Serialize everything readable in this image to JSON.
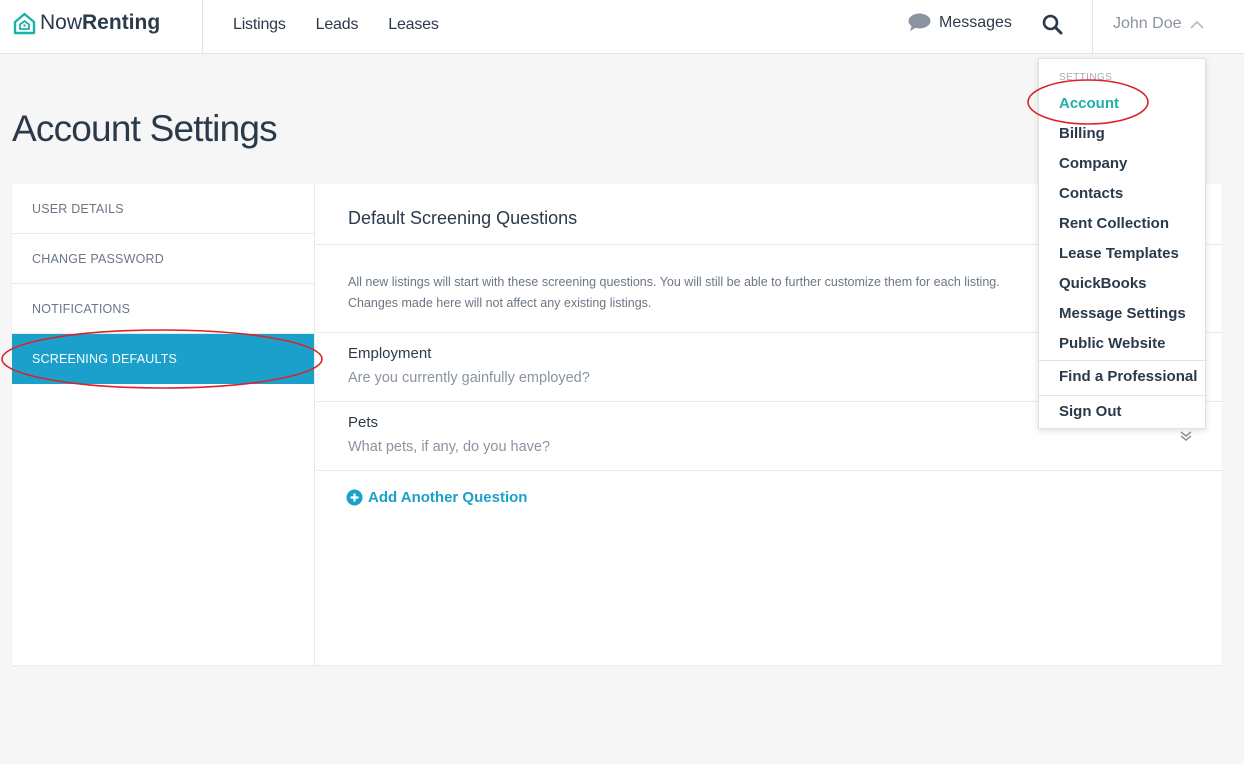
{
  "header": {
    "logo_light": "Now",
    "logo_bold": "Renting",
    "nav": [
      "Listings",
      "Leads",
      "Leases"
    ],
    "messages_label": "Messages",
    "user_name": "John Doe"
  },
  "page_title": "Account Settings",
  "sidebar": {
    "items": [
      {
        "label": "USER DETAILS"
      },
      {
        "label": "CHANGE PASSWORD"
      },
      {
        "label": "NOTIFICATIONS"
      },
      {
        "label": "SCREENING DEFAULTS",
        "active": true
      }
    ]
  },
  "main": {
    "heading": "Default Screening Questions",
    "description_line1": "All new listings will start with these screening questions. You will still be able to further customize them for each listing.",
    "description_line2": "Changes made here will not affect any existing listings.",
    "questions": [
      {
        "title": "Employment",
        "text": "Are you currently gainfully employed?"
      },
      {
        "title": "Pets",
        "text": "What pets, if any, do you have?"
      }
    ],
    "add_question_label": "Add Another Question"
  },
  "dropdown": {
    "caption": "SETTINGS",
    "items": [
      {
        "label": "Account",
        "current": true
      },
      {
        "label": "Billing"
      },
      {
        "label": "Company"
      },
      {
        "label": "Contacts"
      },
      {
        "label": "Rent Collection"
      },
      {
        "label": "Lease Templates"
      },
      {
        "label": "QuickBooks"
      },
      {
        "label": "Message Settings"
      },
      {
        "label": "Public Website"
      },
      {
        "label": "Find a Professional"
      },
      {
        "label": "Sign Out"
      }
    ]
  },
  "colors": {
    "accent": "#1ba0cc",
    "current_link": "#1fb0a8",
    "annotation": "#d9232a"
  }
}
